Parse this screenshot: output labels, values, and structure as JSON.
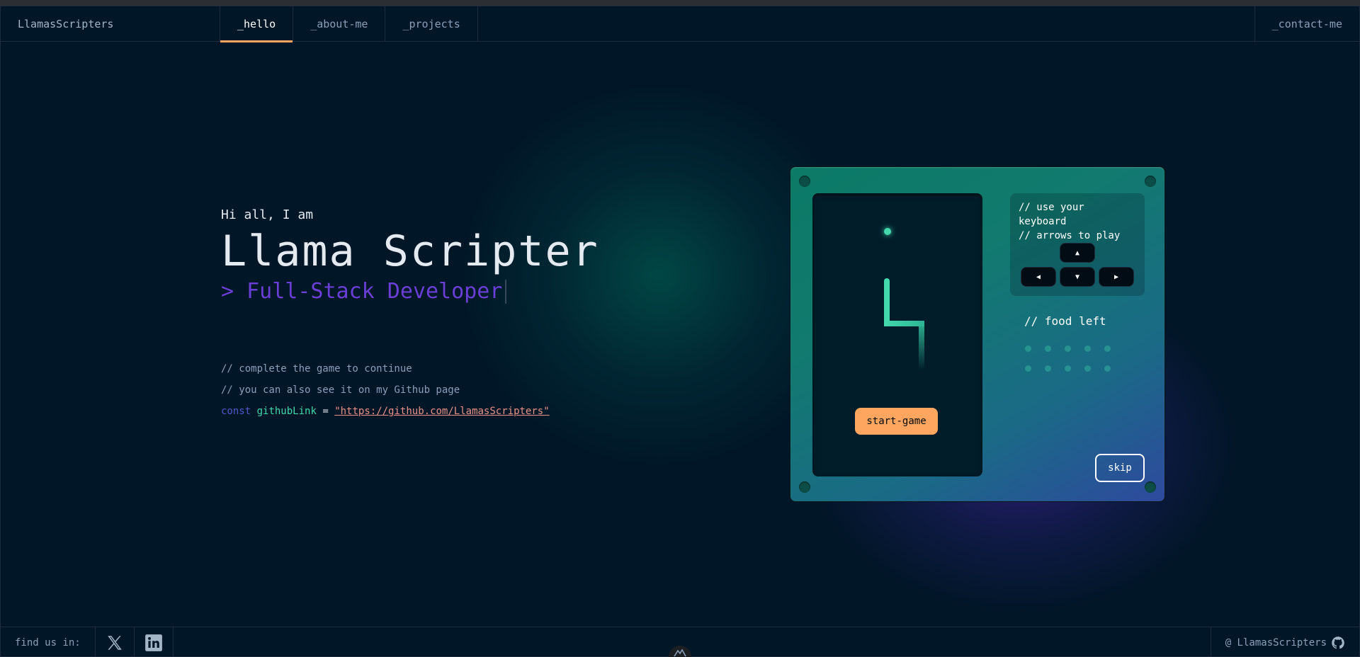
{
  "header": {
    "brand": "LlamasScripters",
    "tabs": [
      {
        "label": "_hello",
        "active": true
      },
      {
        "label": "_about-me",
        "active": false
      },
      {
        "label": "_projects",
        "active": false
      }
    ],
    "contact_label": "_contact-me"
  },
  "hero": {
    "greeting": "Hi all, I am",
    "name": "Llama Scripter",
    "role_prompt": ">",
    "role": "Full-Stack Developer",
    "comment_1": "// complete the game to continue",
    "comment_2": "// you can also see it on my Github page",
    "code_keyword": "const",
    "code_variable": "githubLink",
    "code_equals": "=",
    "code_value": "\"https://github.com/LlamasScripters\""
  },
  "game": {
    "start_label": "start-game",
    "instructions_line1": "// use your keyboard",
    "instructions_line2": "// arrows to play",
    "keys": {
      "up": "▲",
      "left": "◀",
      "down": "▼",
      "right": "▶"
    },
    "food_left_label": "// food left",
    "food_left_count": 10,
    "skip_label": "skip"
  },
  "footer": {
    "find_us_label": "find us in:",
    "socials": [
      "x-icon",
      "linkedin-icon"
    ],
    "github_handle": "@ LlamasScripters"
  },
  "colors": {
    "background": "#011627",
    "accent_orange": "#fea55f",
    "accent_green": "#43d9ad",
    "accent_purple": "#4d5bce",
    "string_red": "#e99287"
  }
}
